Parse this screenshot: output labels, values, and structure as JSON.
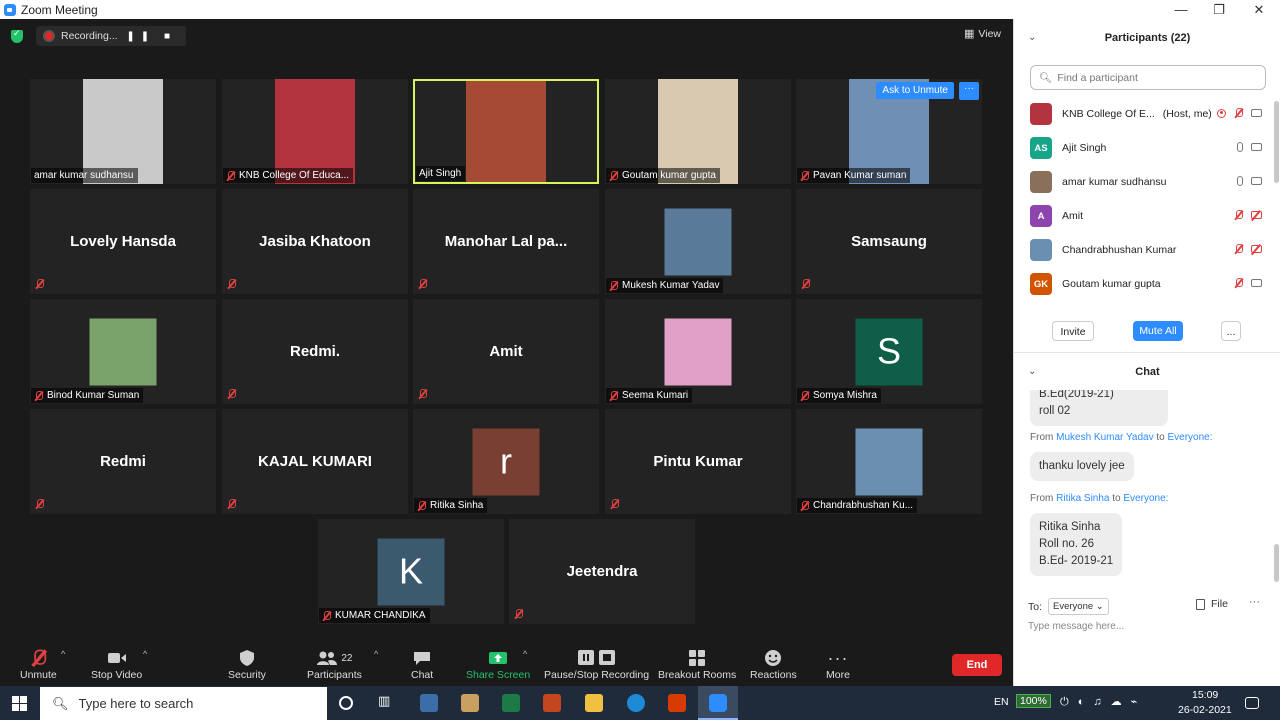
{
  "window": {
    "title": "Zoom Meeting",
    "min": "—",
    "max": "❐",
    "close": "✕"
  },
  "meeting": {
    "recording_label": "Recording...",
    "recording_controls": "❚❚ ■",
    "view_label": "View",
    "ask_unmute": "Ask to Unmute",
    "ask_more": "···"
  },
  "tiles": [
    {
      "name": "amar kumar sudhansu",
      "kind": "video",
      "color": "#c9c9c9",
      "muted": false
    },
    {
      "name": "KNB College Of Educa...",
      "kind": "video",
      "color": "#b3343f",
      "muted": true
    },
    {
      "name": "Ajit Singh",
      "kind": "video",
      "color": "#a44a35",
      "muted": false,
      "active": true
    },
    {
      "name": "Goutam kumar gupta",
      "kind": "video",
      "color": "#d9c9b0",
      "muted": true
    },
    {
      "name": "Pavan Kumar suman",
      "kind": "video",
      "color": "#6f8fb5",
      "muted": true
    },
    {
      "name": "Lovely Hansda",
      "kind": "name"
    },
    {
      "name": "Jasiba Khatoon",
      "kind": "name"
    },
    {
      "name": "Manohar Lal pa...",
      "kind": "name"
    },
    {
      "name": "Mukesh Kumar Yadav",
      "kind": "photo",
      "color": "#5a7a9a",
      "muted": true
    },
    {
      "name": "Samsaung",
      "kind": "name"
    },
    {
      "name": "Binod Kumar Suman",
      "kind": "photo",
      "color": "#7aa36c",
      "muted": true
    },
    {
      "name": "Redmi.",
      "kind": "name"
    },
    {
      "name": "Amit",
      "kind": "name"
    },
    {
      "name": "Seema Kumari",
      "kind": "photo",
      "color": "#e0a0c8",
      "muted": true
    },
    {
      "name": "Somya Mishra",
      "kind": "letter",
      "letter": "S",
      "color": "#0e5e48",
      "muted": true
    },
    {
      "name": "Redmi",
      "kind": "name"
    },
    {
      "name": "KAJAL KUMARI",
      "kind": "name"
    },
    {
      "name": "Ritika Sinha",
      "kind": "letter",
      "letter": "r",
      "color": "#7a3f33",
      "muted": true
    },
    {
      "name": "Pintu Kumar",
      "kind": "name"
    },
    {
      "name": "Chandrabhushan Ku...",
      "kind": "photo",
      "color": "#6a8fb0",
      "muted": true
    },
    {
      "name": "KUMAR CHANDIKA",
      "kind": "letter",
      "letter": "K",
      "color": "#3c5a6e",
      "muted": true
    },
    {
      "name": "Jeetendra",
      "kind": "name"
    }
  ],
  "toolbar": {
    "unmute": "Unmute",
    "stop_video": "Stop Video",
    "security": "Security",
    "participants": "Participants",
    "participants_count": "22",
    "chat": "Chat",
    "share_screen": "Share Screen",
    "pause_stop": "Pause/Stop Recording",
    "breakout": "Breakout Rooms",
    "reactions": "Reactions",
    "more": "More",
    "end": "End",
    "caret": "^"
  },
  "participants_panel": {
    "title": "Participants (22)",
    "search_placeholder": "Find a participant",
    "list": [
      {
        "name": "KNB College Of E...",
        "tag": "(Host, me)",
        "initials": "",
        "color": "#b3343f",
        "audio": "muted",
        "video": "on",
        "rec": true
      },
      {
        "name": "Ajit Singh",
        "tag": "",
        "initials": "AS",
        "color": "#17a589",
        "audio": "on",
        "video": "on"
      },
      {
        "name": "amar kumar sudhansu",
        "tag": "",
        "initials": "",
        "color": "#8a6f5a",
        "audio": "on",
        "video": "on"
      },
      {
        "name": "Amit",
        "tag": "",
        "initials": "A",
        "color": "#8e44ad",
        "audio": "muted",
        "video": "off"
      },
      {
        "name": "Chandrabhushan Kumar",
        "tag": "",
        "initials": "",
        "color": "#6a8fb0",
        "audio": "muted",
        "video": "off"
      },
      {
        "name": "Goutam kumar gupta",
        "tag": "",
        "initials": "GK",
        "color": "#d35400",
        "audio": "muted",
        "video": "on"
      }
    ],
    "invite": "Invite",
    "mute_all": "Mute All",
    "more": "..."
  },
  "chat": {
    "title": "Chat",
    "partial_bubble": [
      "B.Ed(2019-21)",
      "roll 02"
    ],
    "messages": [
      {
        "from_prefix": "From",
        "sender": "Mukesh Kumar Yadav",
        "to_word": "to",
        "recipient": "Everyone:",
        "lines": [
          "thanku lovely jee"
        ]
      },
      {
        "from_prefix": "From",
        "sender": "Ritika Sinha",
        "to_word": "to",
        "recipient": "Everyone:",
        "lines": [
          "Ritika Sinha",
          "Roll no. 26",
          "B.Ed- 2019-21"
        ]
      }
    ],
    "to_label": "To:",
    "to_value": "Everyone",
    "file_label": "File",
    "more": "···",
    "input_placeholder": "Type message here..."
  },
  "taskbar": {
    "search_placeholder": "Type here to search",
    "language": "EN",
    "battery": "100%",
    "time": "15:09",
    "date": "26-02-2021"
  }
}
